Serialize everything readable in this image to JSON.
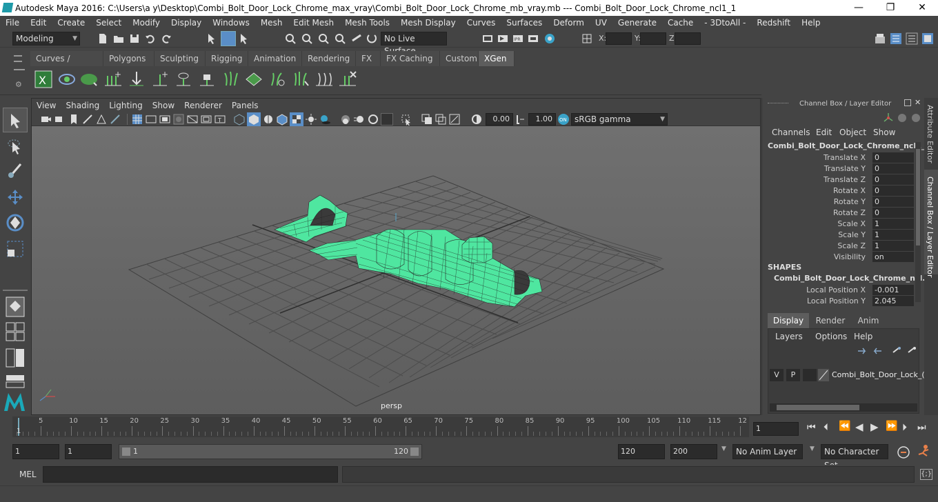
{
  "window": {
    "title": "Autodesk Maya 2016: C:\\Users\\a y\\Desktop\\Combi_Bolt_Door_Lock_Chrome_max_vray\\Combi_Bolt_Door_Lock_Chrome_mb_vray.mb   ---   Combi_Bolt_Door_Lock_Chrome_ncl1_1",
    "minimize": "—",
    "maximize": "❐",
    "close": "✕"
  },
  "menubar": [
    "File",
    "Edit",
    "Create",
    "Select",
    "Modify",
    "Display",
    "Windows",
    "Mesh",
    "Edit Mesh",
    "Mesh Tools",
    "Mesh Display",
    "Curves",
    "Surfaces",
    "Deform",
    "UV",
    "Generate",
    "Cache",
    "- 3DtoAll -",
    "Redshift",
    "Help"
  ],
  "status": {
    "mode": "Modeling",
    "live_surface": "No Live Surface",
    "x_label": "X:",
    "y_label": "Y:",
    "z_label": "Z:"
  },
  "shelf_tabs": [
    "Curves / Surfaces",
    "Polygons",
    "Sculpting",
    "Rigging",
    "Animation",
    "Rendering",
    "FX",
    "FX Caching",
    "Custom",
    "XGen"
  ],
  "shelf_active": "XGen",
  "viewport": {
    "menus": [
      "View",
      "Shading",
      "Lighting",
      "Show",
      "Renderer",
      "Panels"
    ],
    "exposure": "0.00",
    "gamma": "1.00",
    "colorspace": "sRGB gamma",
    "camera_label": "persp"
  },
  "channel_box": {
    "title": "Channel Box / Layer Editor",
    "menus": [
      "Channels",
      "Edit",
      "Object",
      "Show"
    ],
    "object_name": "Combi_Bolt_Door_Lock_Chrome_ncl1_1",
    "attributes": [
      {
        "label": "Translate X",
        "value": "0"
      },
      {
        "label": "Translate Y",
        "value": "0"
      },
      {
        "label": "Translate Z",
        "value": "0"
      },
      {
        "label": "Rotate X",
        "value": "0"
      },
      {
        "label": "Rotate Y",
        "value": "0"
      },
      {
        "label": "Rotate Z",
        "value": "0"
      },
      {
        "label": "Scale X",
        "value": "1"
      },
      {
        "label": "Scale Y",
        "value": "1"
      },
      {
        "label": "Scale Z",
        "value": "1"
      },
      {
        "label": "Visibility",
        "value": "on"
      }
    ],
    "shapes_header": "SHAPES",
    "shape_name": "Combi_Bolt_Door_Lock_Chrome_ncl...",
    "shape_attributes": [
      {
        "label": "Local Position X",
        "value": "-0.001"
      },
      {
        "label": "Local Position Y",
        "value": "2.045"
      }
    ]
  },
  "layer_editor": {
    "tabs": [
      "Display",
      "Render",
      "Anim"
    ],
    "active_tab": "Display",
    "menus": [
      "Layers",
      "Options",
      "Help"
    ],
    "layer": {
      "v": "V",
      "p": "P",
      "name": "Combi_Bolt_Door_Lock_("
    }
  },
  "side_tabs": [
    "Attribute Editor",
    "Channel Box / Layer Editor"
  ],
  "timeline": {
    "ticks": [
      "5",
      "10",
      "15",
      "20",
      "25",
      "30",
      "35",
      "40",
      "45",
      "50",
      "55",
      "60",
      "65",
      "70",
      "75",
      "80",
      "85",
      "90",
      "95",
      "100",
      "105",
      "110",
      "115",
      "12"
    ],
    "start_marker": "1",
    "current_frame": "1"
  },
  "range": {
    "start": "1",
    "anim_start": "1",
    "slider_start": "1",
    "slider_end": "120",
    "anim_end": "120",
    "end": "200",
    "anim_layer": "No Anim Layer",
    "character_set": "No Character Set"
  },
  "command": {
    "mel_label": "MEL"
  }
}
